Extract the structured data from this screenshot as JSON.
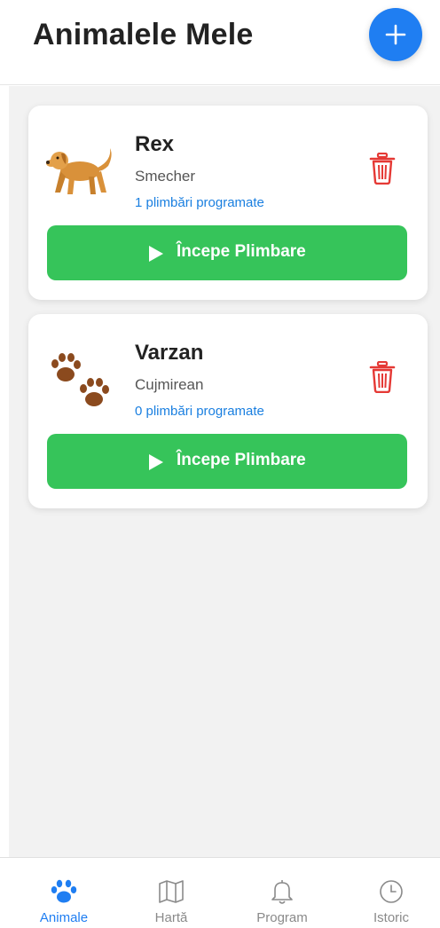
{
  "header": {
    "title": "Animalele Mele",
    "add_icon": "plus-icon"
  },
  "pets": [
    {
      "name": "Rex",
      "breed": "Smecher",
      "walks": "1 plimbări programate",
      "icon": "dog-icon",
      "start_label": "Începe Plimbare"
    },
    {
      "name": "Varzan",
      "breed": "Cujmirean",
      "walks": "0 plimbări programate",
      "icon": "paw-prints-icon",
      "start_label": "Începe Plimbare"
    }
  ],
  "tabs": [
    {
      "label": "Animale",
      "icon": "paw-icon",
      "active": true
    },
    {
      "label": "Hartă",
      "icon": "map-icon",
      "active": false
    },
    {
      "label": "Program",
      "icon": "bell-icon",
      "active": false
    },
    {
      "label": "Istoric",
      "icon": "clock-icon",
      "active": false
    }
  ],
  "colors": {
    "accent": "#1f7ef2",
    "start_button": "#36c45a",
    "delete": "#e53935",
    "link": "#1a7fe0",
    "inactive_tab": "#8a8a8a"
  }
}
